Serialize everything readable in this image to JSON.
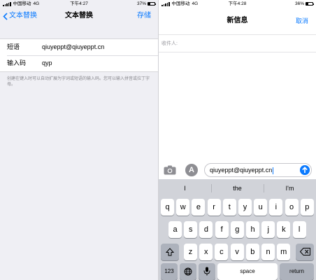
{
  "left": {
    "status": {
      "carrier": "中国移动",
      "network": "4G",
      "time": "下午4:27",
      "battery": "37%",
      "battery_fraction": 0.37
    },
    "nav": {
      "back": "文本替换",
      "title": "文本替换",
      "action": "存储"
    },
    "fields": [
      {
        "label": "短语",
        "value": "qiuyeppt@qiuyeppt.cn"
      },
      {
        "label": "输入码",
        "value": "qyp"
      }
    ],
    "hint": "创建在键入时可以自动扩展为字词或短语的输入码。您可以输入拼音或拉丁字母。"
  },
  "right": {
    "status": {
      "carrier": "中国移动",
      "network": "4G",
      "time": "下午4:28",
      "battery": "36%",
      "battery_fraction": 0.36
    },
    "nav": {
      "title": "新信息",
      "action": "取消"
    },
    "to_label": "收件人:",
    "message": "qiuyeppt@qiuyeppt.cn",
    "appstore_glyph": "A",
    "suggestions": [
      "I",
      "the",
      "I'm"
    ],
    "keys": {
      "row1": [
        "q",
        "w",
        "e",
        "r",
        "t",
        "y",
        "u",
        "i",
        "o",
        "p"
      ],
      "row2": [
        "a",
        "s",
        "d",
        "f",
        "g",
        "h",
        "j",
        "k",
        "l"
      ],
      "row3": [
        "z",
        "x",
        "c",
        "v",
        "b",
        "n",
        "m"
      ],
      "numbers": "123",
      "space": "space",
      "return": "return"
    }
  },
  "colors": {
    "accent": "#0a7aff",
    "keyboard_bg": "#d1d3d9"
  },
  "icons": [
    "chevron-left-icon",
    "signal-icon",
    "battery-icon",
    "camera-icon",
    "appstore-icon",
    "send-arrow-icon",
    "shift-icon",
    "backspace-icon",
    "globe-icon",
    "microphone-icon"
  ]
}
